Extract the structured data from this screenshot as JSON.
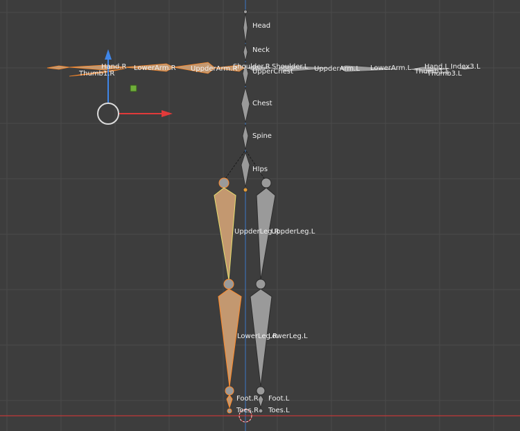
{
  "viewport": {
    "background_color": "#3d3d3d",
    "grid_color": "#4a4a4a",
    "x_axis_color": "#c33a3a",
    "y_axis_color": "#3a78c8"
  },
  "gizmo": {
    "y_arrow_color": "#3f86e8",
    "x_arrow_color": "#e23a3a",
    "pivot_icon": "square-pivot-icon",
    "pivot_color": "#6fae3a"
  },
  "colors": {
    "bone_gray": "#9a9a9a",
    "bone_selected": "#c39870",
    "bone_active_outline": "#e8e070",
    "bone_selected_outline": "#ff8a2a"
  },
  "bones": {
    "head": "Head",
    "neck": "Neck",
    "upper_chest": "UpperChest",
    "chest": "Chest",
    "spine": "Spine",
    "hips": "HIps",
    "shoulder_r": "Shoulder.R",
    "shoulder_l": "Shoulder.L",
    "upper_arm_r": "UppderArm.R",
    "upper_arm_l": "UppderArm.L",
    "lower_arm_r": "LowerArm.R",
    "lower_arm_l": "LowerArm.L",
    "hand_r": "Hand.R",
    "hand_l": "Hand.L",
    "thumb_r": "Thumb1.R",
    "thumb_l": "Thumb1.L",
    "thumb3_l": "Thumb3.L",
    "index_l": "Index3.L",
    "upper_leg_r": "UppderLeg.R",
    "upper_leg_l": "UppderLeg.L",
    "lower_leg_r": "LowerLeg.R",
    "lower_leg_l": "LowerLeg.L",
    "foot_r": "Foot.R",
    "foot_l": "Foot.L",
    "toes_r": "Toes.R",
    "toes_l": "Toes.L"
  }
}
